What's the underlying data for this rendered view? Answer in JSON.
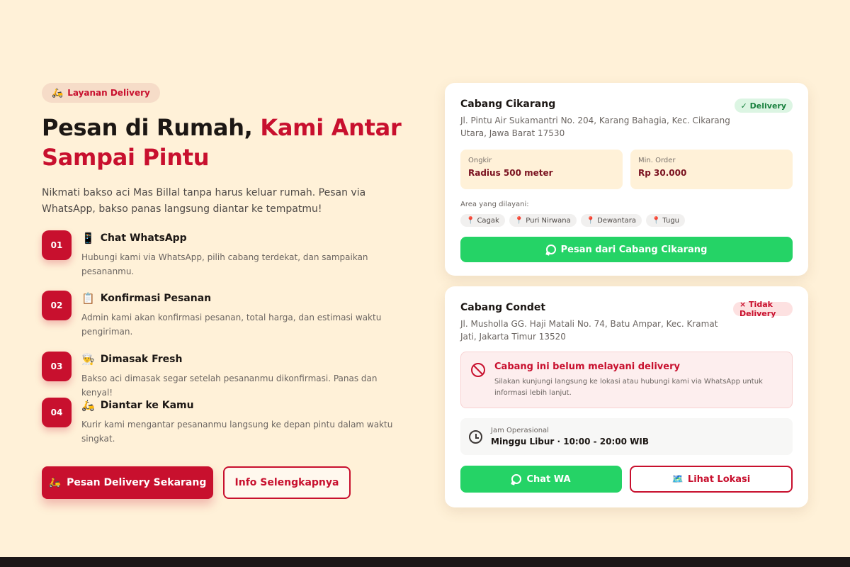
{
  "hero": {
    "badge_icon": "scooter-icon",
    "badge_emoji": "🛵",
    "badge_label": "Layanan Delivery",
    "headline_part1": "Pesan di Rumah, ",
    "headline_accent": "Kami Antar Sampai Pintu",
    "intro": "Nikmati bakso aci Mas Billal tanpa harus keluar rumah. Pesan via WhatsApp, bakso panas langsung diantar ke tempatmu!"
  },
  "steps": [
    {
      "num": "01",
      "emoji": "📱",
      "title": "Chat WhatsApp",
      "desc": "Hubungi kami via WhatsApp, pilih cabang terdekat, dan sampaikan pesananmu."
    },
    {
      "num": "02",
      "emoji": "📋",
      "title": "Konfirmasi Pesanan",
      "desc": "Admin kami akan konfirmasi pesanan, total harga, dan estimasi waktu pengiriman."
    },
    {
      "num": "03",
      "emoji": "👨‍🍳",
      "title": "Dimasak Fresh",
      "desc": "Bakso aci dimasak segar setelah pesananmu dikonfirmasi. Panas dan kenyal!"
    },
    {
      "num": "04",
      "emoji": "🛵",
      "title": "Diantar ke Kamu",
      "desc": "Kurir kami mengantar pesananmu langsung ke depan pintu dalam waktu singkat."
    }
  ],
  "cta": {
    "primary_emoji": "🛵",
    "primary_label": "Pesan Delivery Sekarang",
    "secondary_label": "Info Selengkapnya"
  },
  "branches": [
    {
      "name": "Cabang Cikarang",
      "address": "Jl. Pintu Air Sukamantri No. 204, Karang Bahagia, Kec. Cikarang Utara, Jawa Barat 17530",
      "status": "✓ Delivery",
      "ongkir_label": "Ongkir",
      "ongkir_value": "Radius 500 meter",
      "min_label": "Min. Order",
      "min_value": "Rp 30.000",
      "area_label": "Area yang dilayani:",
      "areas": [
        "Cagak",
        "Puri Nirwana",
        "Dewantara",
        "Tugu"
      ],
      "order_button": "Pesan dari Cabang Cikarang"
    },
    {
      "name": "Cabang Condet",
      "address": "Jl. Musholla GG. Haji Matali No. 74, Batu Ampar, Kec. Kramat Jati, Jakarta Timur 13520",
      "status": "× Tidak Delivery",
      "alert_title": "Cabang ini belum melayani delivery",
      "alert_desc": "Silakan kunjungi langsung ke lokasi atau hubungi kami via WhatsApp untuk informasi lebih lanjut.",
      "hours_label": "Jam Operasional",
      "hours_value": "Minggu Libur · 10:00 - 20:00 WIB",
      "chat_button": "Chat WA",
      "location_emoji": "🗺️",
      "location_button": "Lihat Lokasi"
    }
  ],
  "colors": {
    "accent": "#c8102e",
    "whatsapp": "#25d366",
    "background": "#fff1d8"
  }
}
